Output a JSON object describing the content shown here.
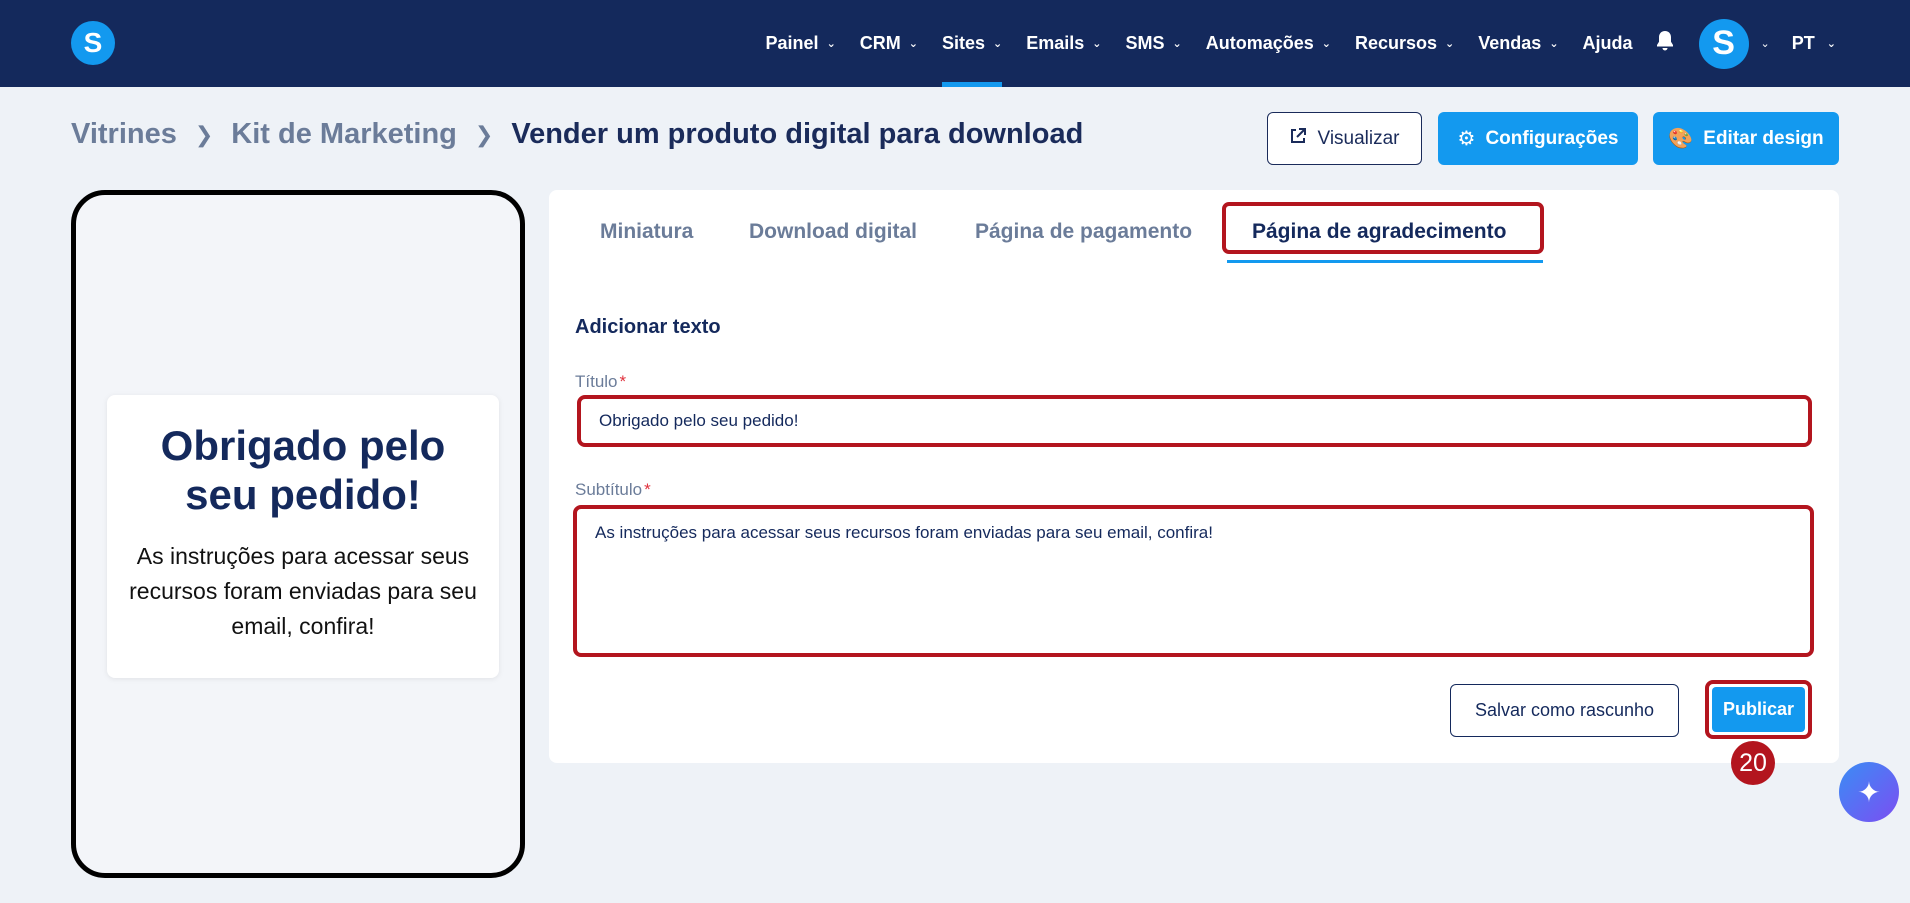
{
  "nav": {
    "logo": "S",
    "items": [
      {
        "label": "Painel",
        "has_menu": true
      },
      {
        "label": "CRM",
        "has_menu": true
      },
      {
        "label": "Sites",
        "has_menu": true,
        "active": true
      },
      {
        "label": "Emails",
        "has_menu": true
      },
      {
        "label": "SMS",
        "has_menu": true
      },
      {
        "label": "Automações",
        "has_menu": true
      },
      {
        "label": "Recursos",
        "has_menu": true
      },
      {
        "label": "Vendas",
        "has_menu": true
      },
      {
        "label": "Ajuda",
        "has_menu": false
      }
    ],
    "bell_icon": "bell-icon",
    "avatar": "S",
    "language": "PT"
  },
  "breadcrumb": {
    "items": [
      "Vitrines",
      "Kit de Marketing"
    ],
    "current": "Vender um produto digital para download"
  },
  "actions": {
    "preview": "Visualizar",
    "settings": "Configurações",
    "edit_design": "Editar design"
  },
  "preview": {
    "title": "Obrigado pelo seu pedido!",
    "subtitle": "As instruções para acessar seus recursos foram enviadas para seu email, confira!"
  },
  "tabs": [
    {
      "label": "Miniatura"
    },
    {
      "label": "Download digital"
    },
    {
      "label": "Página de pagamento"
    },
    {
      "label": "Página de agradecimento",
      "active": true
    }
  ],
  "form": {
    "section_title": "Adicionar texto",
    "title_label": "Título",
    "title_value": "Obrigado pelo seu pedido!",
    "subtitle_label": "Subtítulo",
    "subtitle_value": "As instruções para acessar seus recursos foram enviadas para seu email, confira!",
    "required_mark": "*",
    "save_draft": "Salvar como rascunho",
    "publish": "Publicar"
  },
  "step_badge": "20",
  "colors": {
    "navy": "#14295c",
    "primary": "#1399ef",
    "highlight": "#b3151e"
  }
}
